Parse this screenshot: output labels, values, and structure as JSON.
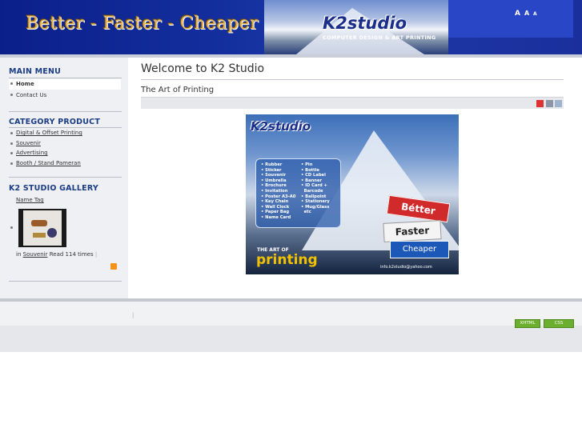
{
  "header": {
    "slogan": "Better - Faster - Cheaper",
    "logo_text": "K2studio",
    "logo_subtitle": "COMPUTER DESIGN & ART PRINTING",
    "font_size_controls": [
      "A",
      "A",
      "A"
    ]
  },
  "main_menu": {
    "title": "MAIN MENU",
    "items": [
      {
        "label": "Home",
        "active": true
      },
      {
        "label": "Contact Us",
        "active": false
      }
    ]
  },
  "category": {
    "title": "CATEGORY PRODUCT",
    "items": [
      "Digital & Offset Printing",
      "Souvenir",
      "Advertising",
      "Booth / Stand Pameran"
    ]
  },
  "gallery": {
    "title": "K2 STUDIO GALLERY",
    "item_name": "Name Tag",
    "caption_prefix": "in",
    "caption_category": "Souvenir",
    "caption_suffix": "Read 114 times"
  },
  "content": {
    "page_title": "Welcome to K2 Studio",
    "article_title": "The Art of Printing",
    "article_icons": [
      "pdf-icon",
      "print-icon",
      "email-icon"
    ]
  },
  "poster": {
    "logo": "K2studio",
    "list_left": "• Rubber\n• Sticker\n• Souvenir\n• Umbrella\n• Brochure\n• Invitation\n• Poster A3-A0\n• Key Chain\n• Wall Clock\n• Paper Bag\n• Name Card",
    "list_right": "• Pin\n• Bottle\n• CD Label\n• Banner\n• ID Card +\n  Barcode\n• Ballpoint\n• Stationery\n• Mug/Glass\n  etc",
    "sign_better": "Bétter",
    "sign_faster": "Faster",
    "sign_cheaper": "Cheaper",
    "art_of": "THE ART OF",
    "printing": "printing",
    "email": "info.k2studio@yahoo.com"
  },
  "footer": {
    "separator": "|",
    "badges": [
      "XHTML",
      "CSS"
    ]
  },
  "colors": {
    "header_blue": "#14309e",
    "module_title": "#1a3d86",
    "badge_green": "#6cae2e"
  }
}
